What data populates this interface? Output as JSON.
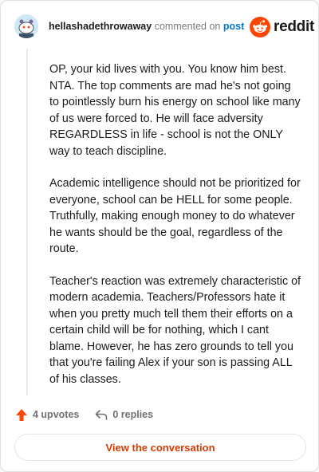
{
  "header": {
    "username": "hellashadethrowaway",
    "action_text": "commented on",
    "post_link": "post",
    "brand": "reddit"
  },
  "comment": {
    "paragraphs": [
      "OP, your kid lives with you. You know him best. NTA. The top comments are mad he's not going to pointlessly burn his energy on school like many of us were forced to. He will face adversity REGARDLESS in life - school is not the ONLY way to teach discipline.",
      "Academic intelligence should not be prioritized for everyone, school can be HELL for some people. Truthfully, making enough money to do whatever he wants should be the goal, regardless of the route.",
      "Teacher's reaction was extremely characteristic of modern academia. Teachers/Professors hate it when you pretty much tell them their efforts on a certain child will be for nothing, which I cant blame. However, he has zero grounds to tell you that you're failing Alex if your son is passing ALL of his classes."
    ]
  },
  "actions": {
    "upvotes": "4 upvotes",
    "replies": "0 replies"
  },
  "cta": {
    "label": "View the conversation"
  },
  "colors": {
    "brand_orange": "#ff4500",
    "link_blue": "#0079d3",
    "cta_text": "#d93a00"
  },
  "icons": [
    "avatar",
    "reddit-logo-icon",
    "upvote-arrow-icon",
    "reply-arrow-icon"
  ]
}
